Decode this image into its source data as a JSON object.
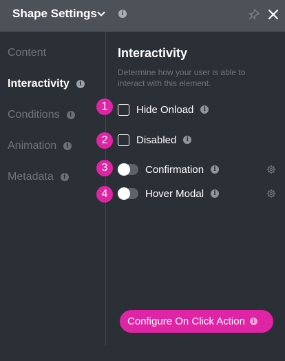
{
  "header": {
    "title": "Shape Settings",
    "info_glyph": "i"
  },
  "sidebar": {
    "items": [
      {
        "label": "Content",
        "active": false
      },
      {
        "label": "Interactivity",
        "active": true
      },
      {
        "label": "Conditions",
        "active": false
      },
      {
        "label": "Animation",
        "active": false
      },
      {
        "label": "Metadata",
        "active": false
      }
    ]
  },
  "main": {
    "title": "Interactivity",
    "description": "Determine how your user is able to interact with this element.",
    "options": [
      {
        "badge": "1",
        "label": "Hide Onload",
        "control": "checkbox",
        "checked": false
      },
      {
        "badge": "2",
        "label": "Disabled",
        "control": "checkbox",
        "checked": false
      },
      {
        "badge": "3",
        "label": "Confirmation",
        "control": "toggle",
        "on": false
      },
      {
        "badge": "4",
        "label": "Hover Modal",
        "control": "toggle",
        "on": false
      }
    ],
    "cta_label": "Configure On Click Action"
  },
  "colors": {
    "accent": "#e024a6",
    "header_bg": "#4c5258",
    "panel_bg": "#2b3036",
    "muted_text": "#6e757c"
  },
  "icons": [
    "chevron-down-icon",
    "info-icon",
    "pin-icon",
    "close-icon",
    "gear-icon"
  ]
}
